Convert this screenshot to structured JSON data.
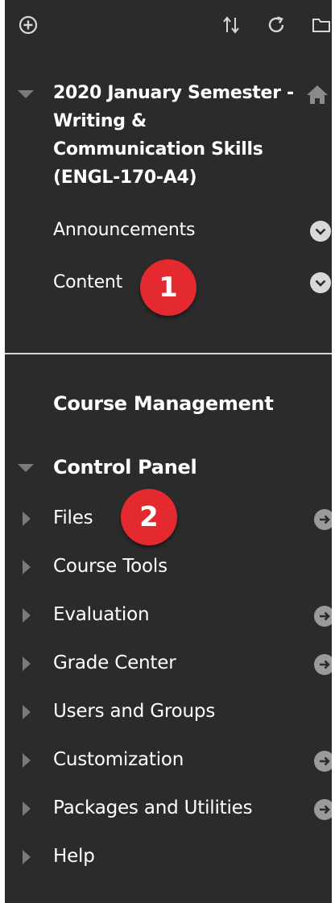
{
  "toolbar": {
    "icons": [
      "add-icon",
      "sort-icon",
      "refresh-icon",
      "folder-icon"
    ]
  },
  "course": {
    "title_lines": [
      "2020 January Semester -",
      "Writing &",
      "Communication Skills",
      "(ENGL-170-A4)"
    ],
    "items": [
      {
        "label": "Announcements"
      },
      {
        "label": "Content"
      }
    ]
  },
  "annotations": {
    "badge1": "1",
    "badge2": "2",
    "color": "#e52a2f"
  },
  "management": {
    "title": "Course Management",
    "control_panel": "Control Panel",
    "items": [
      {
        "label": "Files",
        "has_arrow": true
      },
      {
        "label": "Course Tools",
        "has_arrow": false
      },
      {
        "label": "Evaluation",
        "has_arrow": true
      },
      {
        "label": "Grade Center",
        "has_arrow": true
      },
      {
        "label": "Users and Groups",
        "has_arrow": false
      },
      {
        "label": "Customization",
        "has_arrow": true
      },
      {
        "label": "Packages and Utilities",
        "has_arrow": true
      },
      {
        "label": "Help",
        "has_arrow": false
      }
    ]
  }
}
